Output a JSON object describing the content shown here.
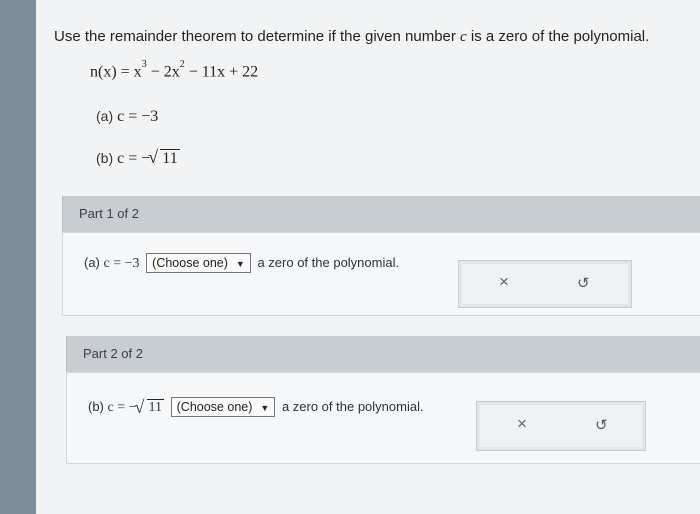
{
  "question": {
    "text_before": "Use the remainder theorem to determine if the given number ",
    "c": "c",
    "text_after": " is a zero of the polynomial."
  },
  "polynomial": {
    "lhs": "n(x) = x",
    "exp1": "3",
    "mid1": " − 2x",
    "exp2": "2",
    "rest": " − 11x + 22"
  },
  "items": {
    "a": {
      "label": "(a)",
      "expr": "c = −3"
    },
    "b": {
      "label": "(b)",
      "expr_prefix": "c = −",
      "radicand": "11"
    }
  },
  "part1": {
    "header": "Part 1 of 2",
    "label": "(a)",
    "expr": "c = −3",
    "select_value": "(Choose one)",
    "select_arrow": "▼",
    "tail": "a zero of the polynomial.",
    "x_icon": "×",
    "undo_icon": "↺"
  },
  "part2": {
    "header": "Part 2 of 2",
    "label": "(b)",
    "expr_prefix": "c = −",
    "radicand": "11",
    "select_value": "(Choose one)",
    "select_arrow": "▼",
    "tail": "a zero of the polynomial.",
    "x_icon": "×",
    "undo_icon": "↺"
  }
}
